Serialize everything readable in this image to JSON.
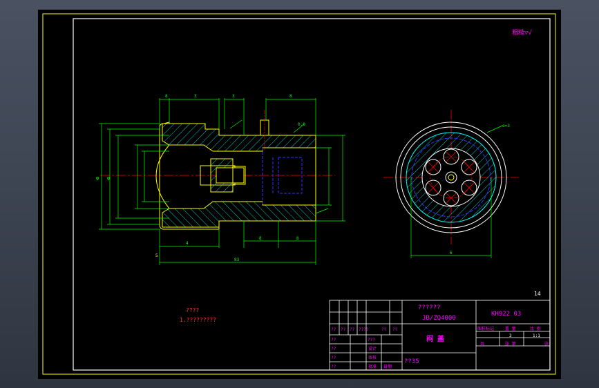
{
  "drawing": {
    "surface_note": "粗糙▽√",
    "page_mark": "14",
    "tech_title": "????",
    "tech_note": "1.?????????",
    "dims": {
      "top_a": "8",
      "top_b": "3",
      "top_c": "3",
      "top_d": "8",
      "dia_outer": "φ",
      "dia_mid": "φ",
      "bottom_a": "4",
      "bottom_b": "8",
      "bottom_c": "8",
      "overall": "83",
      "left_mark": "5",
      "tol": "0.8",
      "side_e": "6",
      "side_e2": "e=3"
    }
  },
  "title_block": {
    "std_line1": "??????",
    "std_line2": "JB/ZQ4000",
    "drawing_no": "KH922 03",
    "part_name": "闷 盖",
    "material": "??35",
    "scale": "1:1",
    "qty": "3",
    "hdr_labels": [
      "图样标记",
      "重 量",
      "比 例"
    ],
    "sheet_labels": [
      "共",
      "张 第",
      "张"
    ],
    "sign_labels": [
      "??",
      "??",
      "??",
      "????",
      "??",
      "??"
    ],
    "role_labels": [
      "设计",
      "审核",
      "批准",
      "日期"
    ],
    "row_labels": [
      "??",
      "??",
      "??",
      "??"
    ],
    "small_q": "???"
  },
  "colors": {
    "canvas": "#000000",
    "frame": "#ffff00",
    "section": "#ffff00",
    "hatch": "#00ffff",
    "dimension": "#00ff00",
    "center": "#ff0000",
    "hidden": "#3333ff",
    "text_magenta": "#ff00ff",
    "text_red": "#ff3333",
    "white": "#ffffff"
  }
}
